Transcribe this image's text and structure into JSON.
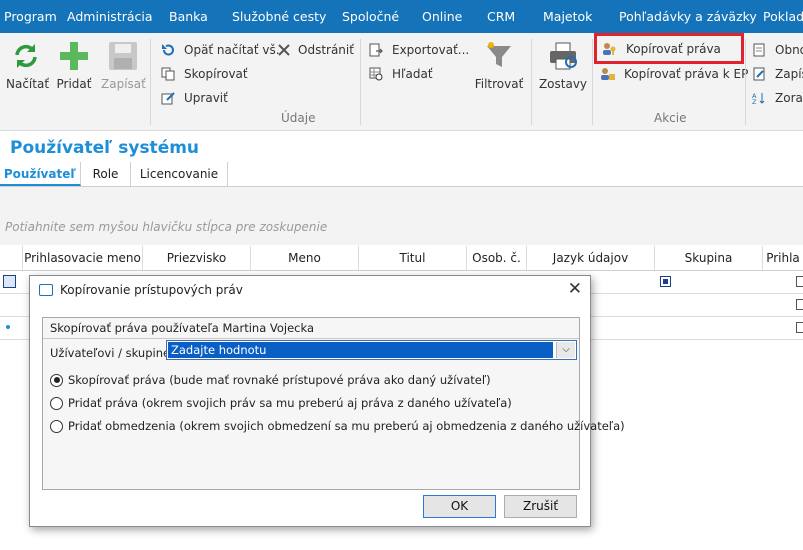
{
  "menu": [
    "Program",
    "Administrácia",
    "Banka",
    "Služobné cesty",
    "Spoločné",
    "Online",
    "CRM",
    "Majetok",
    "Pohľadávky a záväzky",
    "Pokladňa"
  ],
  "ribbon": {
    "nacitat": "Načítať",
    "pridat": "Pridať",
    "zapisat": "Zapísať",
    "opat_nacitat": "Opäť načítať vš.",
    "odstranit": "Odstrániť",
    "skopirovat": "Skopírovať",
    "upravit": "Upraviť",
    "group_udaje": "Údaje",
    "exportovat": "Exportovať...",
    "hladat": "Hľadať",
    "filtrovat": "Filtrovať",
    "zostavy": "Zostavy",
    "kopirovat_prava": "Kopírovať práva",
    "kopirovat_prava_ep": "Kopírovať práva k EP",
    "group_akcie": "Akcie",
    "obno": "Obno",
    "zapis": "Zapís",
    "zorad": "Zorad",
    "highlight_color": "#e0232c"
  },
  "page_title": "Používateľ systému",
  "tabs": [
    "Používateľ",
    "Role",
    "Licencovanie"
  ],
  "group_hint": "Potiahnite sem myšou hlavičku stĺpca pre zoskupenie",
  "columns": [
    "Prihlasovacie meno",
    "Priezvisko",
    "Meno",
    "Titul",
    "Osob. č.",
    "Jazyk údajov",
    "Skupina",
    "Prihla"
  ],
  "dialog": {
    "title": "Kopírovanie prístupových práv",
    "copy_from": "Skopírovať práva používateľa Martina Vojecka",
    "target_label": "Užívateľovi / skupine",
    "target_placeholder": "Zadajte hodnotu",
    "options": [
      "Skopírovať práva (bude mať rovnaké prístupové práva ako daný užívateľ)",
      "Pridať práva (okrem svojich práv sa mu preberú aj práva z daného užívateľa)",
      "Pridať obmedzenia (okrem svojich obmedzení sa mu preberú aj obmedzenia z daného užívateľa)"
    ],
    "selected_option": 0,
    "ok": "OK",
    "cancel": "Zrušiť"
  }
}
